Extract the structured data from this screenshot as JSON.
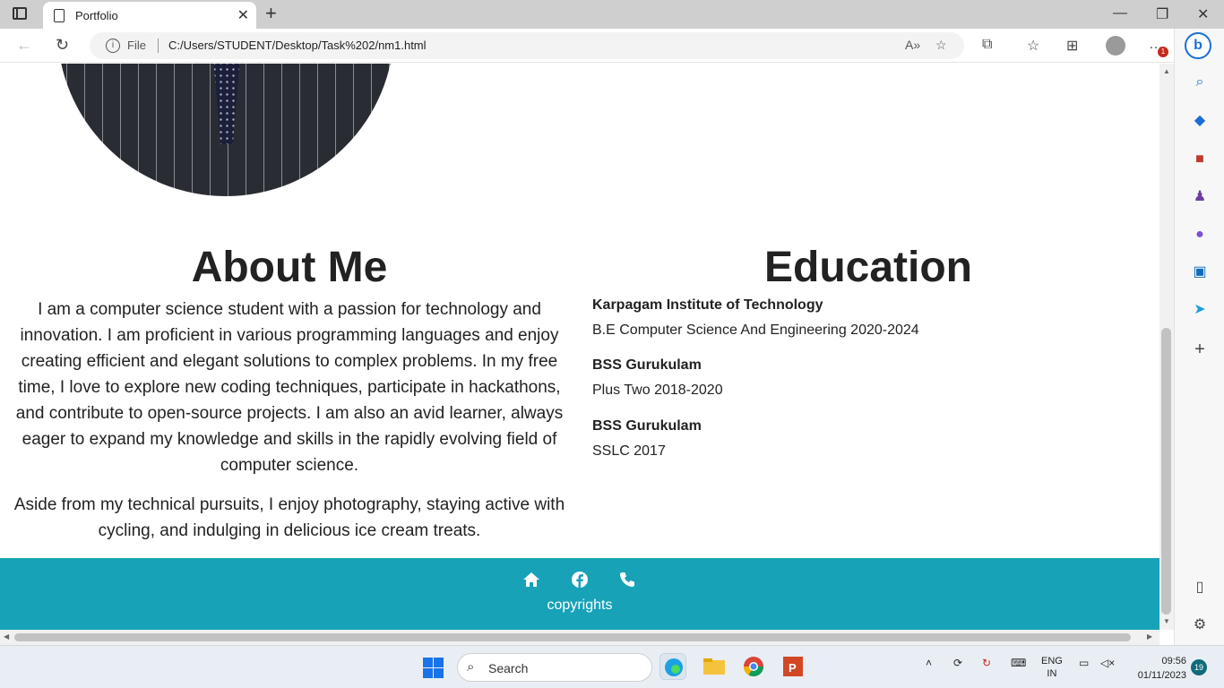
{
  "browser": {
    "tab_title": "Portfolio",
    "file_label": "File",
    "url": "C:/Users/STUDENT/Desktop/Task%202/nm1.html",
    "notification_count": "1"
  },
  "about": {
    "heading": "About Me",
    "paragraph1": "I am a computer science student with a passion for technology and innovation. I am proficient in various programming languages and enjoy creating efficient and elegant solutions to complex problems. In my free time, I love to explore new coding techniques, participate in hackathons, and contribute to open-source projects. I am also an avid learner, always eager to expand my knowledge and skills in the rapidly evolving field of computer science.",
    "paragraph2": "Aside from my technical pursuits, I enjoy photography, staying active with cycling, and indulging in delicious ice cream treats."
  },
  "education": {
    "heading": "Education",
    "entries": [
      {
        "institution": "Karpagam Institute of Technology",
        "course": "B.E Computer Science And Engineering 2020-2024"
      },
      {
        "institution": "BSS Gurukulam",
        "course": "Plus Two 2018-2020"
      },
      {
        "institution": "BSS Gurukulam",
        "course": "SSLC 2017"
      }
    ]
  },
  "footer": {
    "copyright": "copyrights",
    "icons": [
      "home-icon",
      "facebook-icon",
      "phone-icon"
    ],
    "background": "#17a2b8"
  },
  "taskbar": {
    "search_label": "Search",
    "lang": "ENG",
    "region": "IN",
    "time": "09:56",
    "date": "01/11/2023",
    "notifications": "19"
  }
}
